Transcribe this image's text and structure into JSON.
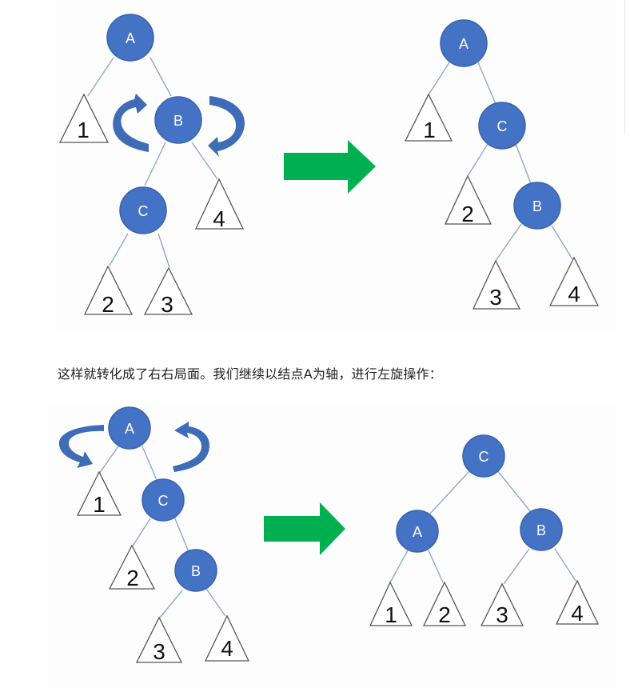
{
  "top_diagram": {
    "before": {
      "nodes": {
        "a": "A",
        "b": "B",
        "c": "C"
      },
      "subtrees": {
        "t1": "1",
        "t2": "2",
        "t3": "3",
        "t4": "4"
      }
    },
    "after": {
      "nodes": {
        "a": "A",
        "c": "C",
        "b": "B"
      },
      "subtrees": {
        "t1": "1",
        "t2": "2",
        "t3": "3",
        "t4": "4"
      }
    }
  },
  "caption": "这样就转化成了右右局面。我们继续以结点A为轴，进行左旋操作：",
  "bottom_diagram": {
    "before": {
      "nodes": {
        "a": "A",
        "c": "C",
        "b": "B"
      },
      "subtrees": {
        "t1": "1",
        "t2": "2",
        "t3": "3",
        "t4": "4"
      }
    },
    "after": {
      "nodes": {
        "c": "C",
        "a": "A",
        "b": "B"
      },
      "subtrees": {
        "t1": "1",
        "t2": "2",
        "t3": "3",
        "t4": "4"
      }
    }
  },
  "colors": {
    "node_fill": "#4472c4",
    "rotation_arrow": "#3e6cb6",
    "transform_arrow": "#00b050"
  }
}
